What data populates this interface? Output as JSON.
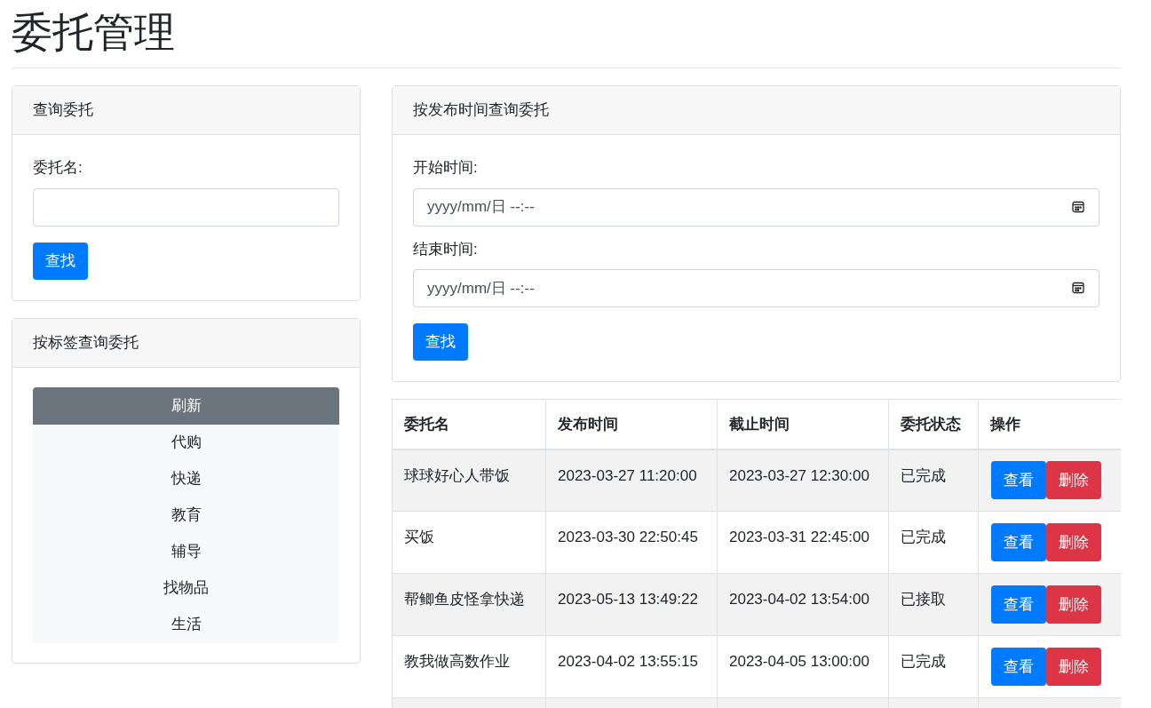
{
  "title": "委托管理",
  "name_search": {
    "header": "查询委托",
    "label": "委托名:",
    "button": "查找"
  },
  "tag_search": {
    "header": "按标签查询委托",
    "tags": [
      {
        "label": "刷新",
        "selected": true
      },
      {
        "label": "代购",
        "selected": false
      },
      {
        "label": "快递",
        "selected": false
      },
      {
        "label": "教育",
        "selected": false
      },
      {
        "label": "辅导",
        "selected": false
      },
      {
        "label": "找物品",
        "selected": false
      },
      {
        "label": "生活",
        "selected": false
      }
    ]
  },
  "time_search": {
    "header": "按发布时间查询委托",
    "fields": [
      {
        "label": "开始时间:",
        "placeholder": "yyyy/mm/日 --:--"
      },
      {
        "label": "结束时间:",
        "placeholder": "yyyy/mm/日 --:--"
      }
    ],
    "button": "查找"
  },
  "table": {
    "columns": [
      "委托名",
      "发布时间",
      "截止时间",
      "委托状态",
      "操作"
    ],
    "rows": [
      {
        "name": "球球好心人带饭",
        "published": "2023-03-27 11:20:00",
        "deadline": "2023-03-27 12:30:00",
        "status": "已完成",
        "actions": [
          "查看",
          "删除"
        ]
      },
      {
        "name": "买饭",
        "published": "2023-03-30 22:50:45",
        "deadline": "2023-03-31 22:45:00",
        "status": "已完成",
        "actions": [
          "查看",
          "删除"
        ]
      },
      {
        "name": "帮鲫鱼皮怪拿快递",
        "published": "2023-05-13 13:49:22",
        "deadline": "2023-04-02 13:54:00",
        "status": "已接取",
        "actions": [
          "查看",
          "删除"
        ]
      },
      {
        "name": "教我做高数作业",
        "published": "2023-04-02 13:55:15",
        "deadline": "2023-04-05 13:00:00",
        "status": "已完成",
        "actions": [
          "查看",
          "删除"
        ]
      }
    ]
  }
}
